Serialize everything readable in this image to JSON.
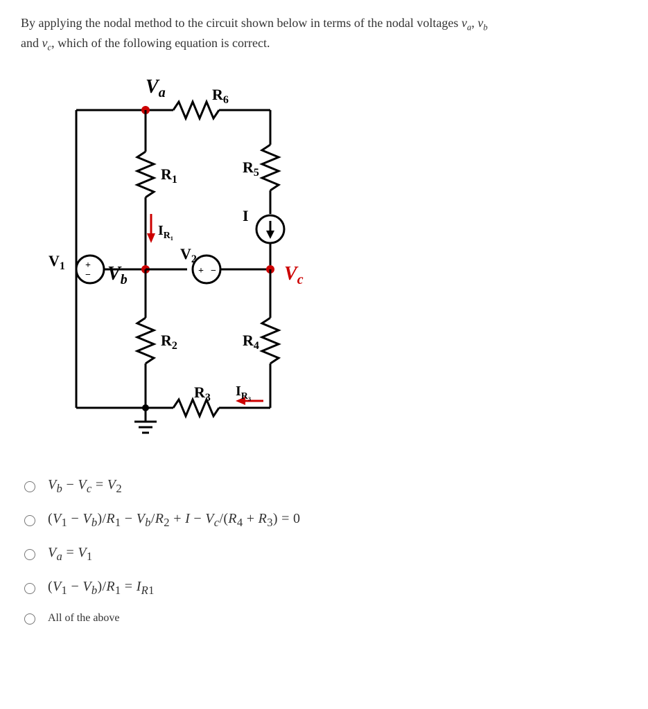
{
  "prompt": {
    "line1_a": "By applying the nodal method to the circuit shown below in terms of the nodal voltages ",
    "va": "v",
    "va_sub": "a",
    "comma": ", ",
    "vb": "v",
    "vb_sub": "b",
    "line2_a": "and ",
    "vc": "v",
    "vc_sub": "c",
    "line2_b": ", which of the following equation is correct."
  },
  "circuit": {
    "labels": {
      "Va": "V",
      "Va_sub": "a",
      "Vb": "V",
      "Vb_sub": "b",
      "Vc": "V",
      "Vc_sub": "c",
      "R1": "R",
      "R1_sub": "1",
      "R2": "R",
      "R2_sub": "2",
      "R3": "R",
      "R3_sub": "3",
      "R4": "R",
      "R4_sub": "4",
      "R5": "R",
      "R5_sub": "5",
      "R6": "R",
      "R6_sub": "6",
      "V1": "V",
      "V1_sub": "1",
      "V2": "V",
      "V2_sub": "2",
      "I": "I",
      "IR1": "I",
      "IR1_sub": "R₁",
      "IR3": "I",
      "IR3_sub": "R₃"
    }
  },
  "options": {
    "opt1": "V_b − V_c = V₂",
    "opt2": "(V₁ − V_b)/R₁ − V_b/R₂ + I − V_c/(R₄ + R₃) = 0",
    "opt3": "V_a = V₁",
    "opt4": "(V₁ − V_b)/R₁ = I_R1",
    "opt5": "All of the above"
  }
}
